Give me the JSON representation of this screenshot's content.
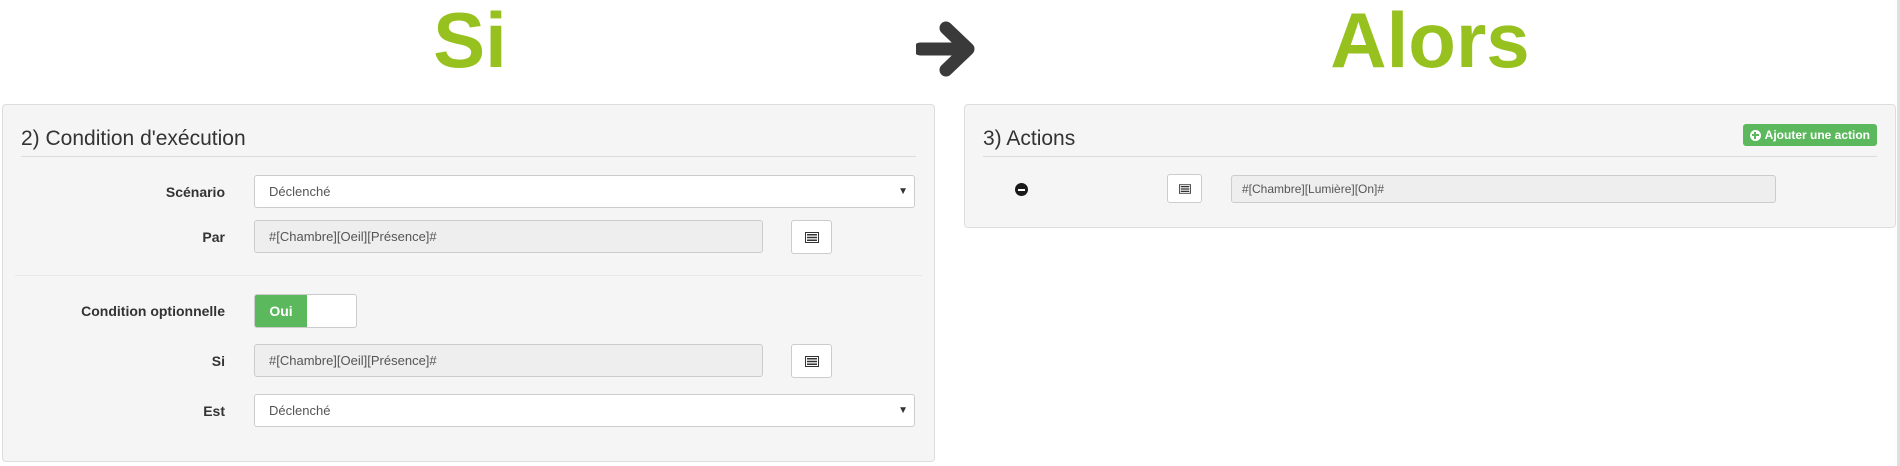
{
  "header": {
    "si_title": "Si",
    "alors_title": "Alors"
  },
  "condition_panel": {
    "heading": "2) Condition d'exécution",
    "scenario": {
      "label": "Scénario",
      "value": "Déclenché"
    },
    "par": {
      "label": "Par",
      "value": "#[Chambre][Oeil][Présence]#"
    },
    "optional": {
      "label": "Condition optionnelle",
      "toggle_on_label": "Oui"
    },
    "si": {
      "label": "Si",
      "value": "#[Chambre][Oeil][Présence]#"
    },
    "est": {
      "label": "Est",
      "value": "Déclenché"
    }
  },
  "actions_panel": {
    "heading": "3) Actions",
    "add_button_label": "Ajouter une action",
    "actions": [
      {
        "value": "#[Chambre][Lumière][On]#"
      }
    ]
  },
  "colors": {
    "title_green": "#97c11f",
    "button_green": "#5cb85c",
    "arrow": "#3a3a3a"
  },
  "icons": [
    "arrow-right-icon",
    "list-alt-icon",
    "plus-circle-icon",
    "minus-circle-icon",
    "caret-down-icon"
  ]
}
